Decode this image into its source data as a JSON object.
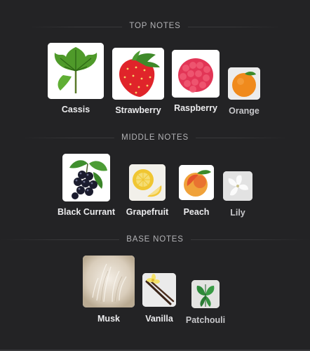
{
  "sections": {
    "top": {
      "title": "TOP NOTES",
      "notes": [
        {
          "label": "Cassis",
          "icon": "cassis-leaf-icon"
        },
        {
          "label": "Strawberry",
          "icon": "strawberry-icon"
        },
        {
          "label": "Raspberry",
          "icon": "raspberry-icon"
        },
        {
          "label": "Orange",
          "icon": "orange-icon"
        }
      ]
    },
    "middle": {
      "title": "MIDDLE NOTES",
      "notes": [
        {
          "label": "Black Currant",
          "icon": "black-currant-icon"
        },
        {
          "label": "Grapefruit",
          "icon": "grapefruit-icon"
        },
        {
          "label": "Peach",
          "icon": "peach-icon"
        },
        {
          "label": "Lily",
          "icon": "lily-icon"
        }
      ]
    },
    "base": {
      "title": "BASE NOTES",
      "notes": [
        {
          "label": "Musk",
          "icon": "musk-icon"
        },
        {
          "label": "Vanilla",
          "icon": "vanilla-icon"
        },
        {
          "label": "Patchouli",
          "icon": "patchouli-icon"
        }
      ]
    }
  },
  "colors": {
    "background": "#232325",
    "label_text": "#ececee",
    "title_text": "#b3b3b6"
  }
}
